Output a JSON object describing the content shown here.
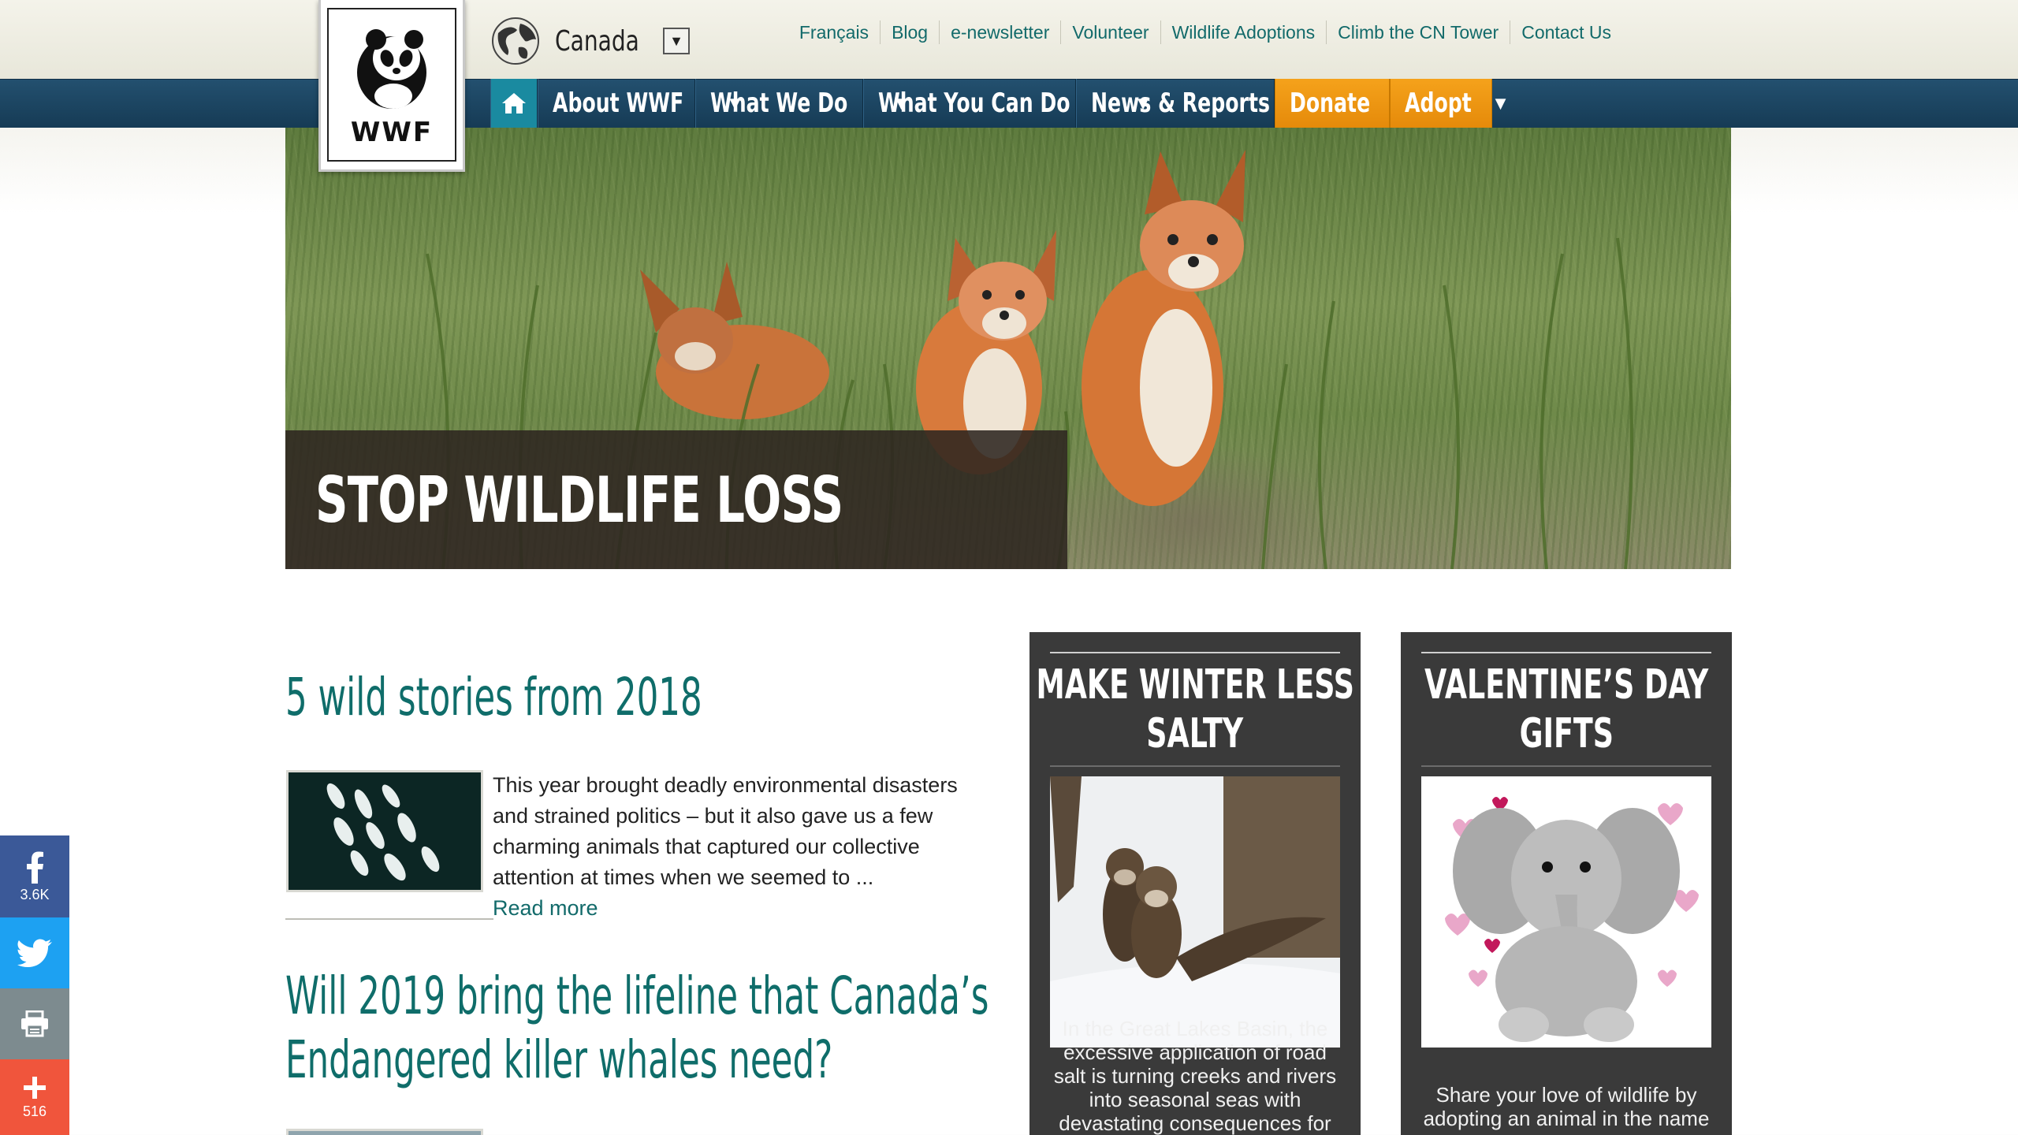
{
  "logo": {
    "text": "WWF"
  },
  "region": {
    "label": "Canada",
    "select_glyph": "▼"
  },
  "utility_links": [
    "Français",
    "Blog",
    "e-newsletter",
    "Volunteer",
    "Wildlife Adoptions",
    "Climb the CN Tower",
    "Contact Us"
  ],
  "nav": {
    "home_icon": "home-icon",
    "items": [
      {
        "label": "About WWF",
        "caret": "▼"
      },
      {
        "label": "What We Do",
        "caret": "▼"
      },
      {
        "label": "What You Can Do",
        "caret": "▼"
      },
      {
        "label": "News & Reports",
        "caret": "▼"
      }
    ],
    "donate": {
      "label": "Donate",
      "caret": "▼"
    },
    "adopt": {
      "label": "Adopt",
      "caret": "▼"
    }
  },
  "hero": {
    "title": "STOP WILDLIFE LOSS"
  },
  "articles": [
    {
      "title": "5 wild stories from 2018",
      "excerpt": "This year brought deadly environmental disasters and strained politics – but it also gave us a few charming animals that captured our collective attention at times when we seemed to ...",
      "read_more": "Read more"
    },
    {
      "title_line1": "Will 2019 bring the lifeline that Canada’s",
      "title_line2": "Endangered killer whales need?"
    }
  ],
  "promos": [
    {
      "title_line1": "MAKE WINTER LESS",
      "title_line2": "SALTY",
      "text": "In the Great Lakes Basin, the excessive application of road salt is turning creeks and rivers into seasonal seas with devastating consequences for"
    },
    {
      "title_line1": "VALENTINE’S DAY",
      "title_line2": "GIFTS",
      "text": "Share your love of wildlife by adopting an animal in the name"
    }
  ],
  "share": {
    "facebook": {
      "icon": "facebook-icon",
      "count": "3.6K",
      "color": "#3b5998"
    },
    "twitter": {
      "icon": "twitter-icon",
      "color": "#1da1f2"
    },
    "print": {
      "icon": "print-icon",
      "color": "#7d8b8f"
    },
    "more": {
      "icon": "plus-icon",
      "count": "516",
      "color": "#f0553c"
    }
  }
}
